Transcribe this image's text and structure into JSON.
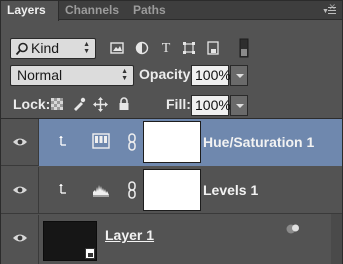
{
  "tabs": [
    {
      "label": "Layers",
      "active": true
    },
    {
      "label": "Channels",
      "active": false
    },
    {
      "label": "Paths",
      "active": false
    }
  ],
  "close_glyph": "✕",
  "filter": {
    "kind_label": "Kind",
    "search_icon": "search-icon",
    "filter_icons": [
      "pixel-layer-filter-icon",
      "adjustment-layer-filter-icon",
      "type-layer-filter-icon",
      "shape-layer-filter-icon",
      "smart-object-filter-icon",
      "filter-toggle-icon"
    ]
  },
  "blend": {
    "mode": "Normal",
    "opacity_label": "Opacity:",
    "opacity_value": "100%"
  },
  "lock": {
    "label": "Lock:",
    "icons": [
      "lock-transparent-pixels-icon",
      "lock-image-pixels-icon",
      "lock-position-icon",
      "lock-all-icon"
    ],
    "fill_label": "Fill:",
    "fill_value": "100%"
  },
  "layers": [
    {
      "name": "Hue/Saturation 1",
      "type": "hue-saturation",
      "selected": true,
      "visible": true,
      "clipped": true
    },
    {
      "name": "Levels 1",
      "type": "levels",
      "selected": false,
      "visible": true,
      "clipped": true
    },
    {
      "name": "Layer 1",
      "type": "pixel",
      "selected": false,
      "visible": true,
      "clipped": false,
      "underlined": true
    }
  ],
  "colors": {
    "panel_bg": "#535353",
    "selected_row": "#6f88ae",
    "tab_bar": "#3e3e3e"
  }
}
